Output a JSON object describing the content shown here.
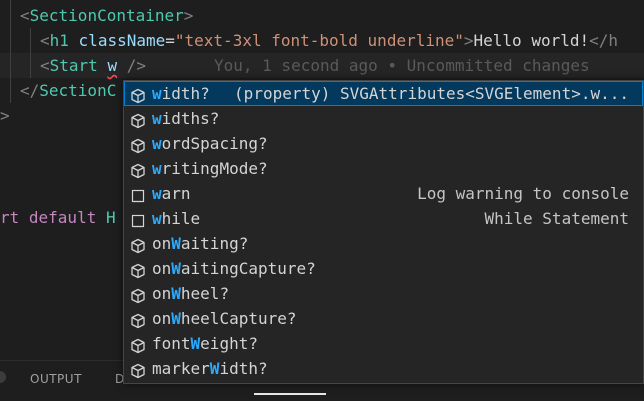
{
  "code": {
    "line1": {
      "open": "<",
      "tag": "SectionContainer",
      "close": ">"
    },
    "line2": {
      "open": "<",
      "tag": "h1",
      "attr": "className",
      "eq": "=",
      "str": "\"text-3xl font-bold underline\"",
      "close": ">",
      "text": "Hello world!",
      "endtag": "</h"
    },
    "line3": {
      "open": "<",
      "tag": "Start",
      "typed": "w",
      "selfclose": "/>",
      "blame": "You, 1 second ago • Uncommitted changes"
    },
    "line4": {
      "open": "</",
      "tag": "SectionC"
    },
    "line5": {
      "close": ">"
    },
    "line6": {
      "kw": "rt default",
      "ident": "H"
    }
  },
  "suggest": {
    "items": [
      {
        "pre": "",
        "match": "w",
        "post": "idth?",
        "kind": "property",
        "detail": "(property) SVGAttributes<SVGElement>.w..."
      },
      {
        "pre": "",
        "match": "w",
        "post": "idths?",
        "kind": "property",
        "detail": ""
      },
      {
        "pre": "",
        "match": "w",
        "post": "ordSpacing?",
        "kind": "property",
        "detail": ""
      },
      {
        "pre": "",
        "match": "w",
        "post": "ritingMode?",
        "kind": "property",
        "detail": ""
      },
      {
        "pre": "",
        "match": "w",
        "post": "arn",
        "kind": "snippet",
        "detail": "Log warning to console"
      },
      {
        "pre": "",
        "match": "w",
        "post": "hile",
        "kind": "snippet",
        "detail": "While Statement"
      },
      {
        "pre": "on",
        "match": "W",
        "post": "aiting?",
        "kind": "property",
        "detail": ""
      },
      {
        "pre": "on",
        "match": "W",
        "post": "aitingCapture?",
        "kind": "property",
        "detail": ""
      },
      {
        "pre": "on",
        "match": "W",
        "post": "heel?",
        "kind": "property",
        "detail": ""
      },
      {
        "pre": "on",
        "match": "W",
        "post": "heelCapture?",
        "kind": "property",
        "detail": ""
      },
      {
        "pre": "font",
        "match": "W",
        "post": "eight?",
        "kind": "property",
        "detail": ""
      },
      {
        "pre": "marker",
        "match": "W",
        "post": "idth?",
        "kind": "property",
        "detail": ""
      }
    ]
  },
  "panel": {
    "output_label": "OUTPUT",
    "next_label": "D"
  },
  "colors": {
    "accent": "#2aaaff",
    "selection": "#04395e",
    "tag": "#4ec9b0",
    "string": "#ce9178",
    "attribute": "#9cdcfe"
  }
}
